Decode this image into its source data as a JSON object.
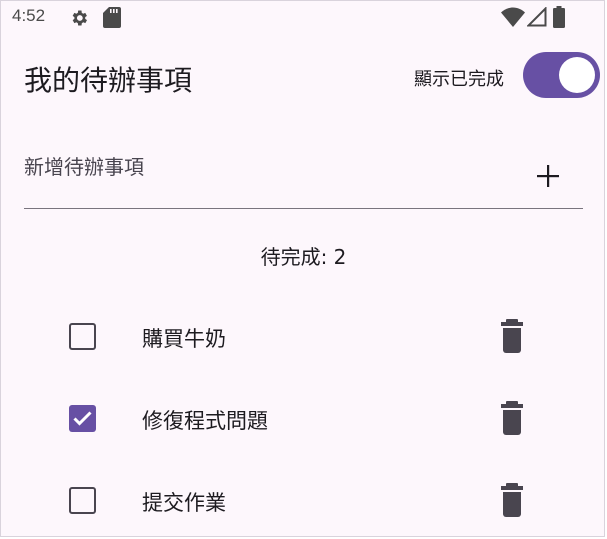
{
  "status_bar": {
    "time": "4:52",
    "icons": [
      "gear-icon",
      "sd-card-icon",
      "wifi-icon",
      "signal-icon",
      "battery-icon"
    ]
  },
  "app_bar": {
    "title": "我的待辦事項",
    "show_done_label": "顯示已完成",
    "show_done_enabled": true
  },
  "new_todo": {
    "placeholder": "新增待辦事項",
    "value": ""
  },
  "pending": {
    "text": "待完成: 2"
  },
  "todos": [
    {
      "text": "購買牛奶",
      "done": false
    },
    {
      "text": "修復程式問題",
      "done": true
    },
    {
      "text": "提交作業",
      "done": false
    }
  ],
  "colors": {
    "accent": "#6750a4",
    "background": "#fdf7fc",
    "text": "#1d1b20",
    "icon": "#49454f"
  }
}
